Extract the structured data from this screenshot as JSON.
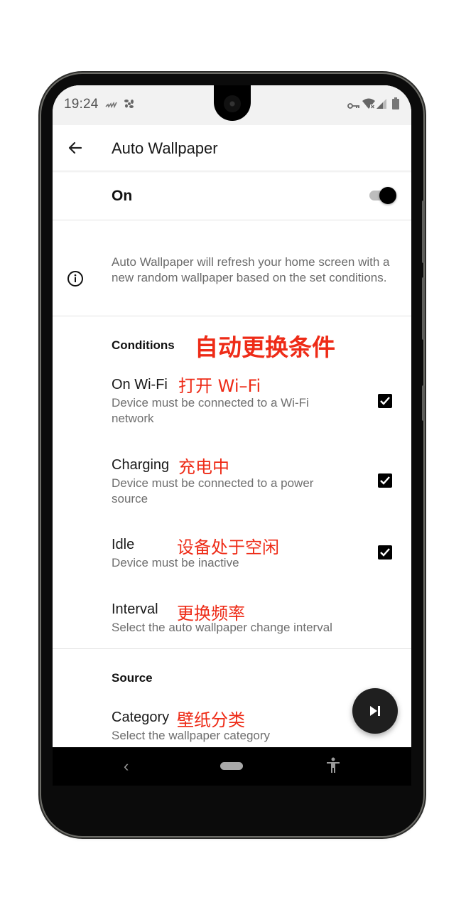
{
  "status_bar": {
    "time": "19:24",
    "left_icons": [
      "signal-wave-icon",
      "fan-icon"
    ],
    "right_icons": [
      "vpn-key-icon",
      "wifi-x-icon",
      "cell-signal-icon",
      "battery-icon"
    ]
  },
  "app_bar": {
    "back_icon": "arrow-left-icon",
    "title": "Auto Wallpaper"
  },
  "master_switch": {
    "label": "On",
    "checked": true
  },
  "info": {
    "icon": "info-icon",
    "text": "Auto Wallpaper will refresh your home screen with a new random wallpaper based on the set conditions."
  },
  "conditions": {
    "header": "Conditions",
    "header_annotation": "自动更换条件",
    "items": [
      {
        "title": "On Wi-Fi",
        "annotation": "打开 Wi–Fi",
        "subtitle": "Device must be connected to a Wi-Fi network",
        "checked": true
      },
      {
        "title": "Charging",
        "annotation": "充电中",
        "subtitle": "Device must be connected to a power source",
        "checked": true
      },
      {
        "title": "Idle",
        "annotation": "设备处于空闲",
        "subtitle": "Device must be inactive",
        "checked": true
      },
      {
        "title": "Interval",
        "annotation": "更换频率",
        "subtitle": "Select the auto wallpaper change interval"
      }
    ]
  },
  "source": {
    "header": "Source",
    "items": [
      {
        "title": "Category",
        "annotation": "壁纸分类",
        "subtitle": "Select the wallpaper category"
      }
    ]
  },
  "fab": {
    "icon": "skip-next-icon"
  },
  "nav_bar": {
    "back": "‹",
    "home_icon": "home-pill-icon",
    "accessibility_icon": "accessibility-icon"
  },
  "colors": {
    "annotation": "#ee2b17",
    "checkbox": "#000000",
    "fab": "#1f1f1f"
  }
}
